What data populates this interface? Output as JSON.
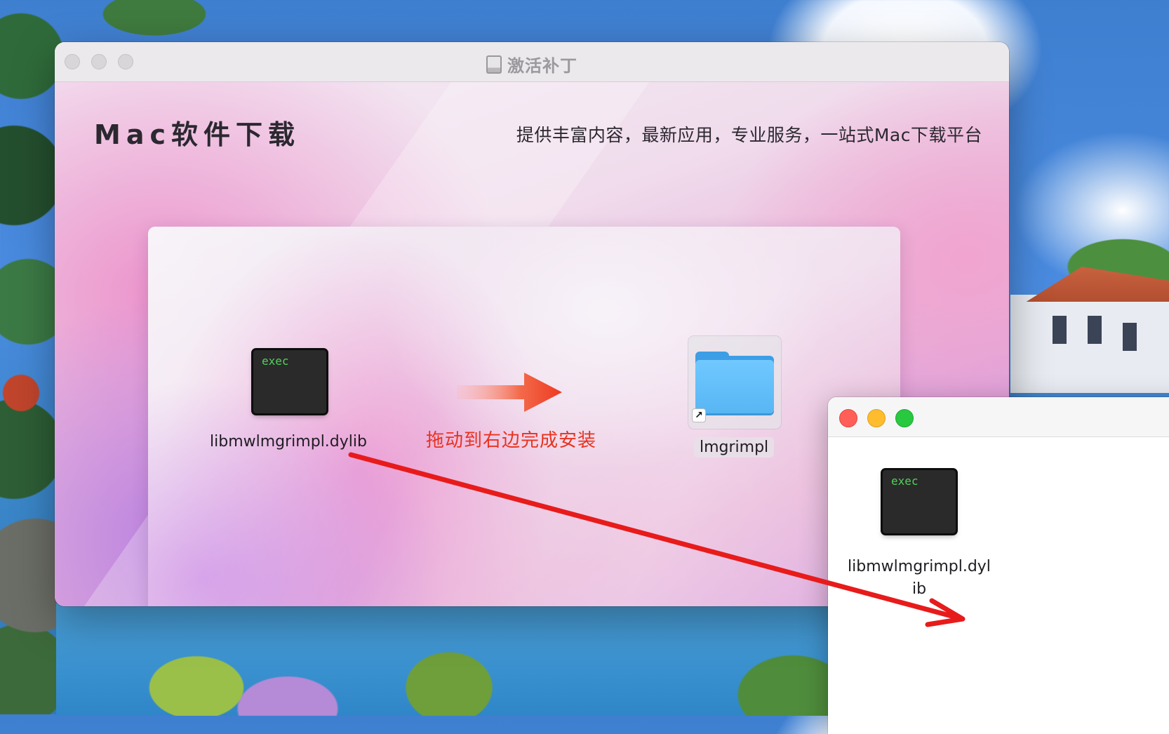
{
  "window": {
    "title": "激活补丁"
  },
  "header": {
    "brand": "Mac软件下载",
    "slogan": "提供丰富内容，最新应用，专业服务，一站式Mac下载平台"
  },
  "installer": {
    "source_file": {
      "icon_text": "exec",
      "name": "libmwlmgrimpl.dylib",
      "icon": "terminal-exec-icon"
    },
    "hint": "拖动到右边完成安装",
    "target_folder": {
      "name": "lmgrimpl",
      "icon": "folder-alias-icon"
    }
  },
  "finder_window": {
    "file": {
      "icon_text": "exec",
      "name_line1": "libmwlmgrimpl.dyl",
      "name_line2": "ib",
      "icon": "terminal-exec-icon"
    }
  },
  "colors": {
    "hint_red": "#e8321e",
    "arrow_red": "#e81b1b",
    "traffic_close": "#ff5f57",
    "traffic_min": "#febc2e",
    "traffic_max": "#28c840"
  }
}
